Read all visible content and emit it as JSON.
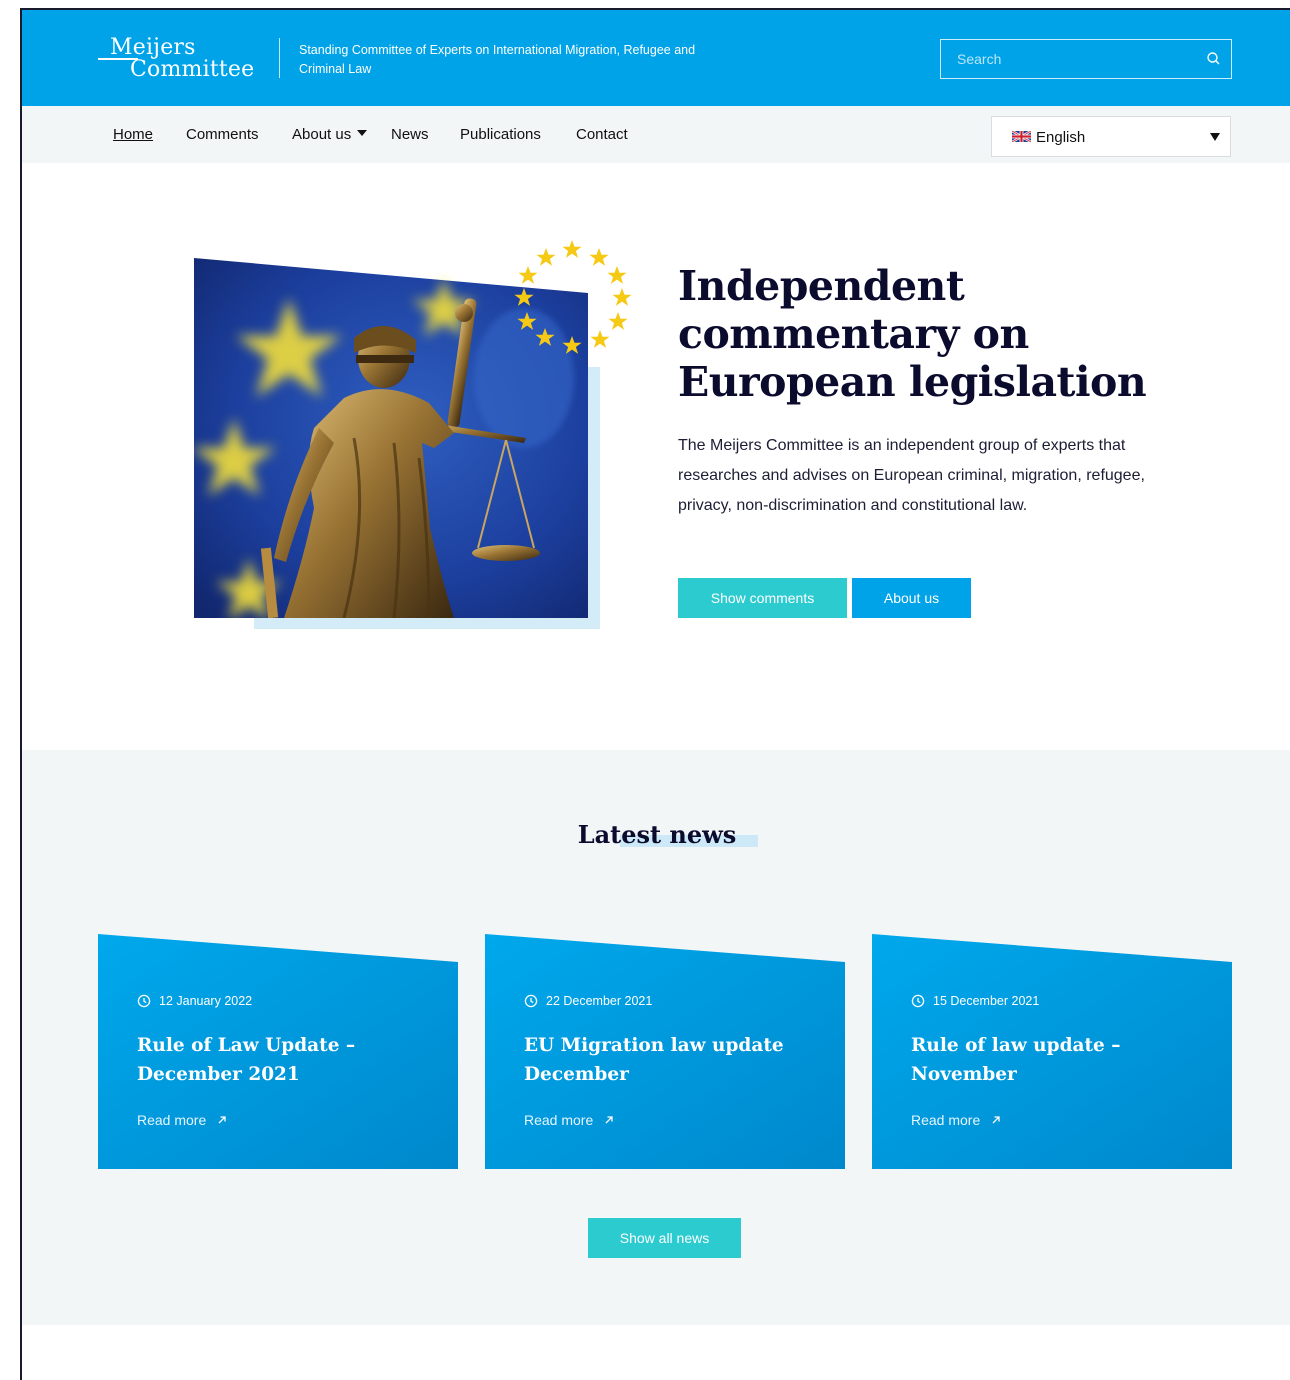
{
  "header": {
    "logo_line1": "Meijers",
    "logo_line2": "Committee",
    "tagline": "Standing Committee of Experts on International Migration, Refugee and Criminal Law",
    "search_placeholder": "Search",
    "search_icon": "search-icon"
  },
  "nav": {
    "items": [
      {
        "label": "Home",
        "active": true
      },
      {
        "label": "Comments"
      },
      {
        "label": "About us",
        "dropdown": true
      },
      {
        "label": "News"
      },
      {
        "label": "Publications"
      },
      {
        "label": "Contact"
      }
    ],
    "language": {
      "label": "English",
      "flag_icon": "uk-flag-icon"
    }
  },
  "hero": {
    "title": "Independent commentary on European legislation",
    "description": "The Meijers Committee is an independent group of experts that researches and advises on European criminal, migration, refugee, privacy, non-discrimination and constitutional law.",
    "buttons": {
      "show_comments": "Show comments",
      "about_us": "About us"
    }
  },
  "news": {
    "heading": "Latest news",
    "cards": [
      {
        "date": "12 January 2022",
        "title": "Rule of Law Update – December 2021",
        "read_more": "Read more"
      },
      {
        "date": "22 December 2021",
        "title": "EU Migration law update December",
        "read_more": "Read more"
      },
      {
        "date": "15 December 2021",
        "title": "Rule of law update – November",
        "read_more": "Read more"
      }
    ],
    "show_all": "Show all news"
  },
  "colors": {
    "header_blue": "#00a3e8",
    "teal": "#2ccbd0",
    "nav_bg": "#f2f6f7",
    "heading_navy": "#0b0b2e",
    "star_yellow": "#f6c915"
  }
}
